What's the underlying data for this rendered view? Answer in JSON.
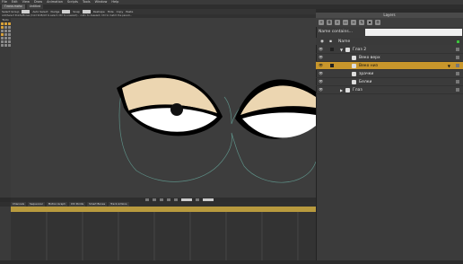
{
  "menu": [
    "File",
    "Edit",
    "View",
    "Draw",
    "Animation",
    "Scripts",
    "Tools",
    "Window",
    "Help"
  ],
  "doc_tabs": [
    {
      "label": "Глаза.moho",
      "active": true
    },
    {
      "label": "Untitled",
      "active": false
    }
  ],
  "tool_options": {
    "labels": [
      "Select Group",
      "Auto Select",
      "Nudge",
      "Snap",
      "Reshape",
      "Hide",
      "Copy",
      "Paste"
    ]
  },
  "status_text": "Add/Select Points/Bones (hold Shift/Alt to select, Ctrl to unselect) - <all> to deselect, Ctrl to match the parent...",
  "tools_title": "Tools",
  "timeline": {
    "tabs": [
      "Channels",
      "Sequencer",
      "Motion Graph",
      "Ctrl Points",
      "Smart Bones",
      "Track Actions"
    ]
  },
  "layers_panel": {
    "title": "Layers",
    "toolbar_icons": [
      "new-layer-icon",
      "duplicate-icon",
      "delete-icon",
      "folder-icon",
      "settings-icon",
      "arrows-icon",
      "lock-icon",
      "gear-icon"
    ],
    "filter_label": "Name contains...",
    "filter_value": "",
    "header_name": "Name",
    "rows": [
      {
        "name": "Глаз 2",
        "indent": 1,
        "type": "group",
        "selected": false,
        "expanded": true,
        "has_box": true
      },
      {
        "name": "Веко верх",
        "indent": 2,
        "type": "vector",
        "selected": false,
        "has_box": false
      },
      {
        "name": "Веко низ",
        "indent": 2,
        "type": "vector",
        "selected": true,
        "has_box": true
      },
      {
        "name": "зрачки",
        "indent": 2,
        "type": "vector",
        "selected": false,
        "has_box": false
      },
      {
        "name": "Белки",
        "indent": 2,
        "type": "vector",
        "selected": false,
        "has_box": false
      },
      {
        "name": "Глаз",
        "indent": 1,
        "type": "group",
        "selected": false,
        "expanded": false,
        "has_box": false
      }
    ]
  },
  "colors": {
    "accent_selection": "#c8962b",
    "eyelid_fill": "#ecd6b1",
    "eye_white": "#ffffff",
    "outline": "#000000",
    "pupil": "#111111",
    "guide_curve": "#5d8f86"
  }
}
